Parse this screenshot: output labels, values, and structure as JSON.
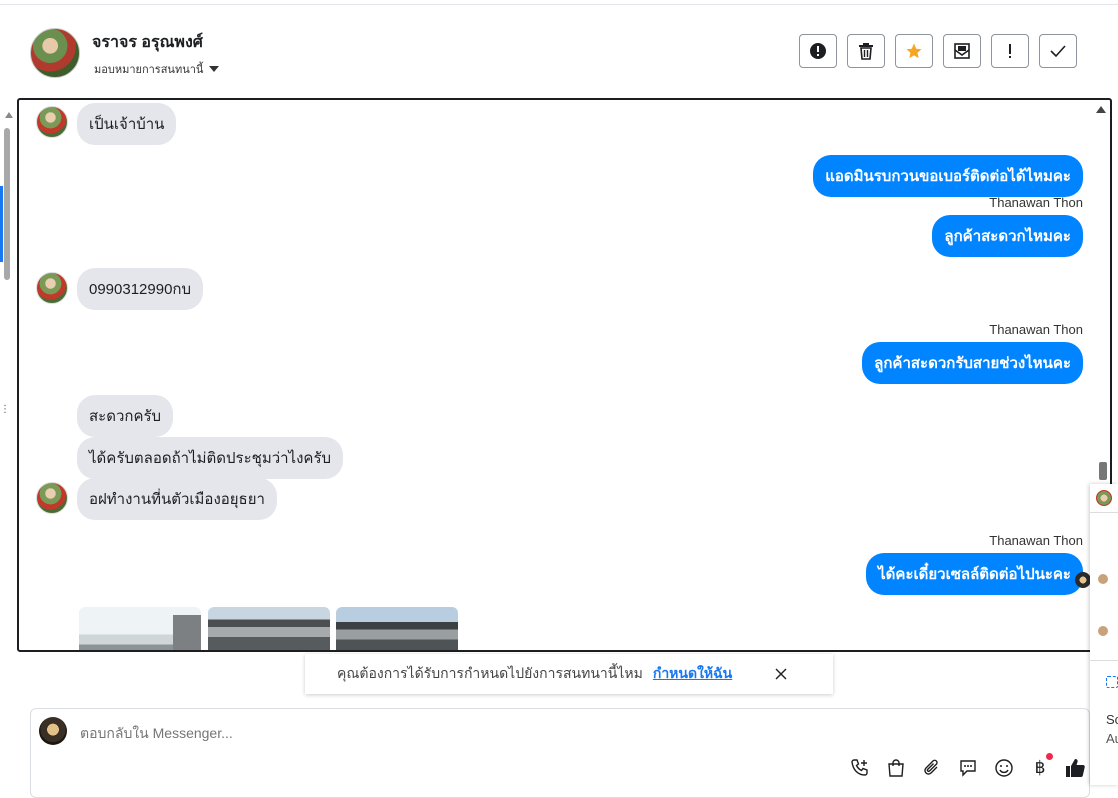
{
  "header": {
    "customer_name": "จราจร อรุณพงศ์",
    "assign_label": "มอบหมายการสนทนานี้",
    "toolbar": [
      {
        "name": "spam-button",
        "icon": "alert-circle-icon"
      },
      {
        "name": "delete-button",
        "icon": "trash-icon"
      },
      {
        "name": "star-button",
        "icon": "star-icon"
      },
      {
        "name": "mark-unread-button",
        "icon": "envelope-icon"
      },
      {
        "name": "follow-up-button",
        "icon": "exclamation-icon"
      },
      {
        "name": "done-button",
        "icon": "check-icon"
      }
    ],
    "star_color": "#f5a623"
  },
  "messages": {
    "m1": "เป็นเจ้าบ้าน",
    "m2": "แอดมินรบกวนขอเบอร์ติดต่อได้ไหมคะ",
    "m3_sender": "Thanawan Thon",
    "m3": "ลูกค้าสะดวกไหมคะ",
    "m4": "0990312990กบ",
    "m5_sender": "Thanawan Thon",
    "m5": "ลูกค้าสะดวกรับสายช่วงไหนคะ",
    "m6": "สะดวกครับ",
    "m7": "ได้ครับตลอดถ้าไม่ติดประชุมว่าไงครับ",
    "m8": "อฝทำงานที่นตัวเมืองอยุธยา",
    "m9_sender": "Thanawan Thon",
    "m9": "ได้คะเดี๋ยวเซลล์ติดต่อไปนะคะ"
  },
  "colors": {
    "outgoing": "#0084ff",
    "incoming": "#e4e6eb",
    "accent": "#1877f2"
  },
  "prompt": {
    "text": "คุณต้องการได้รับการกำหนดไปยังการสนทนานี้ไหม",
    "link": "กำหนดให้ฉัน"
  },
  "composer": {
    "placeholder": "ตอบกลับใน Messenger...",
    "icons": [
      "phone-add-icon",
      "shopping-bag-icon",
      "paperclip-icon",
      "saved-reply-icon",
      "emoji-icon",
      "baht-icon",
      "thumbs-up-icon"
    ]
  },
  "right_panel": {
    "text1": "Sc",
    "text2": "Au"
  }
}
